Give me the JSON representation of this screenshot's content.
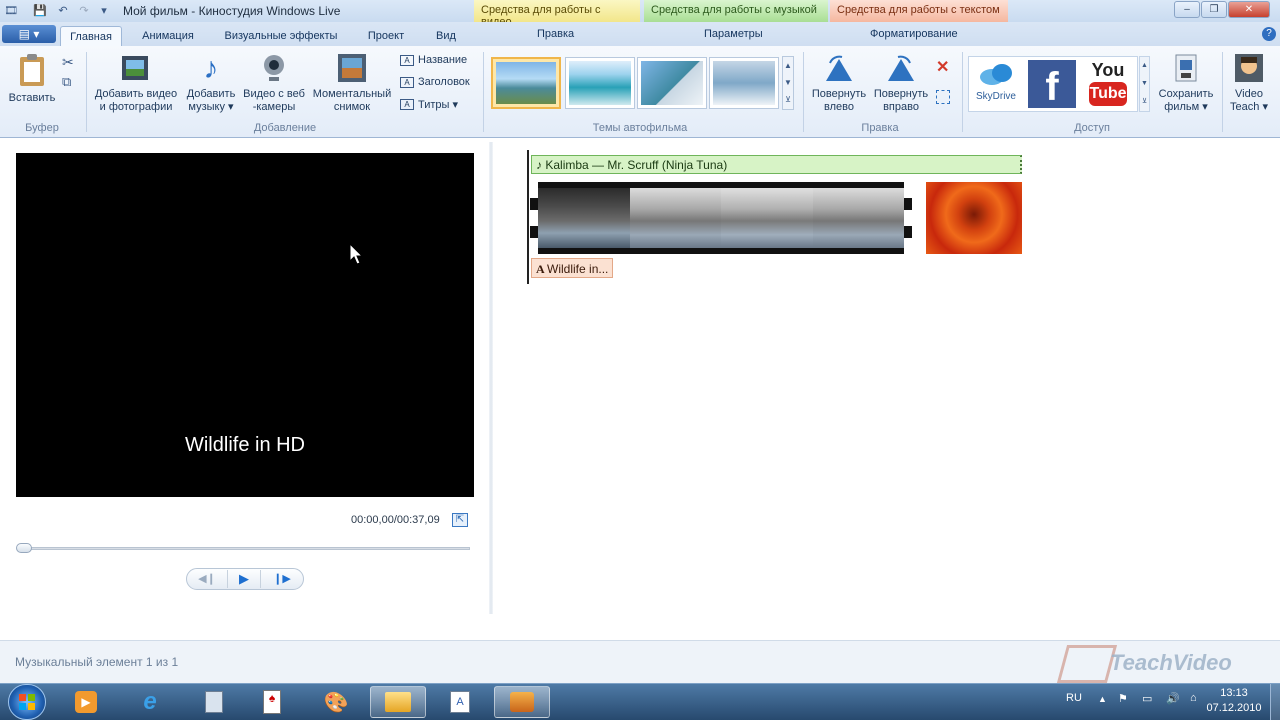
{
  "window": {
    "title": "Мой фильм - Киностудия Windows Live",
    "contextual_tabs": [
      "Средства для работы с видео",
      "Средства для работы с музыкой",
      "Средства для работы с текстом"
    ],
    "context_subtabs": [
      "Правка",
      "Параметры",
      "Форматирование"
    ]
  },
  "ribbon_tabs": [
    "Главная",
    "Анимация",
    "Визуальные эффекты",
    "Проект",
    "Вид"
  ],
  "ribbon": {
    "clipboard": {
      "paste": "Вставить",
      "group": "Буфер"
    },
    "add": {
      "add_video": [
        "Добавить видео",
        "и фотографии"
      ],
      "add_music": [
        "Добавить",
        "музыку ▾"
      ],
      "webcam": [
        "Видео с веб",
        "-камеры"
      ],
      "snapshot": [
        "Моментальный",
        "снимок"
      ],
      "title": "Название",
      "caption": "Заголовок",
      "credits": "Титры ▾",
      "group": "Добавление"
    },
    "themes": {
      "group": "Темы автофильма"
    },
    "edit": {
      "rotate_left": [
        "Повернуть",
        "влево"
      ],
      "rotate_right": [
        "Повернуть",
        "вправо"
      ],
      "group": "Правка"
    },
    "share": {
      "skydrive": "SkyDrive",
      "youtube_top": "You",
      "youtube_bottom": "Tube",
      "save": [
        "Сохранить",
        "фильм ▾"
      ],
      "group": "Доступ"
    },
    "videoteach": [
      "Video",
      "Teach ▾"
    ]
  },
  "preview": {
    "title_text": "Wildlife in HD",
    "time": "00:00,00/00:37,09",
    "progress": 0.0
  },
  "timeline": {
    "music_item": "Kalimba — Mr. Scruff (Ninja Tuna)",
    "title_item": "Wildlife in..."
  },
  "status": {
    "text": "Музыкальный элемент 1 из 1"
  },
  "watermark": "TeachVideo",
  "taskbar": {
    "lang": "RU",
    "time": "13:13",
    "date": "07.12.2010"
  },
  "colors": {
    "accent": "#2a5ea8",
    "music_bar": "#d7f3c6",
    "title_bar": "#fbe1d2"
  }
}
